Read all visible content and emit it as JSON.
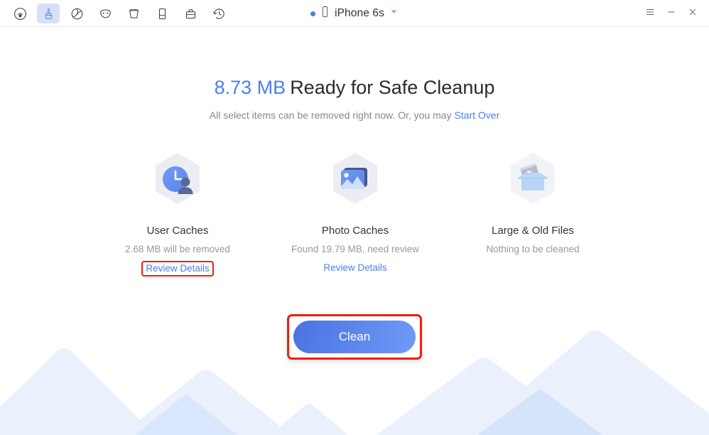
{
  "window": {
    "device": {
      "name": "iPhone 6s",
      "status_dot_color": "#4a7ff0",
      "phone_icon": "phone-icon",
      "dropdown_icon": "chevron-down-icon"
    },
    "controls": [
      {
        "name": "menu-button",
        "icon": "hamburger-menu-icon"
      },
      {
        "name": "minimize-button",
        "icon": "minimize-icon"
      },
      {
        "name": "close-button",
        "icon": "close-icon"
      }
    ],
    "toolbar": [
      {
        "name": "toolbar-item-phone-clean",
        "icon": "signal-drop-icon",
        "active": false
      },
      {
        "name": "toolbar-item-cleaner",
        "icon": "brush-icon",
        "active": true
      },
      {
        "name": "toolbar-item-app-manager",
        "icon": "circle-slash-icon",
        "active": false
      },
      {
        "name": "toolbar-item-privacy",
        "icon": "mask-icon",
        "active": false
      },
      {
        "name": "toolbar-item-eraser",
        "icon": "bucket-icon",
        "active": false
      },
      {
        "name": "toolbar-item-device",
        "icon": "device-icon",
        "active": false
      },
      {
        "name": "toolbar-item-toolkit",
        "icon": "briefcase-icon",
        "active": false
      },
      {
        "name": "toolbar-item-history",
        "icon": "clock-history-icon",
        "active": false
      }
    ]
  },
  "main": {
    "headline_size": "8.73 MB",
    "headline_text": "Ready for Safe Cleanup",
    "subtitle_text": "All select items can be removed right now. Or, you may ",
    "start_over_label": "Start Over",
    "clean_button_label": "Clean",
    "cards": [
      {
        "id": "user-caches",
        "icon": "clock-user-icon",
        "title": "User Caches",
        "subtitle": "2.68 MB will be removed",
        "link_label": "Review Details",
        "link_highlighted": true
      },
      {
        "id": "photo-caches",
        "icon": "photo-icon",
        "title": "Photo Caches",
        "subtitle": "Found 19.79 MB, need review",
        "link_label": "Review Details",
        "link_highlighted": false
      },
      {
        "id": "large-old-files",
        "icon": "box-film-icon",
        "title": "Large & Old Files",
        "subtitle": "Nothing to be cleaned",
        "link_label": "",
        "link_highlighted": false
      }
    ]
  },
  "colors": {
    "accent": "#4a7ff0",
    "headline": "#2b2b2b",
    "muted": "#999999",
    "highlight_red": "#f21c0b",
    "toolbar_active_bg": "#d7e0fa",
    "mountain_light": "#eaf1fd",
    "mountain_dark": "#d6e4fa"
  }
}
